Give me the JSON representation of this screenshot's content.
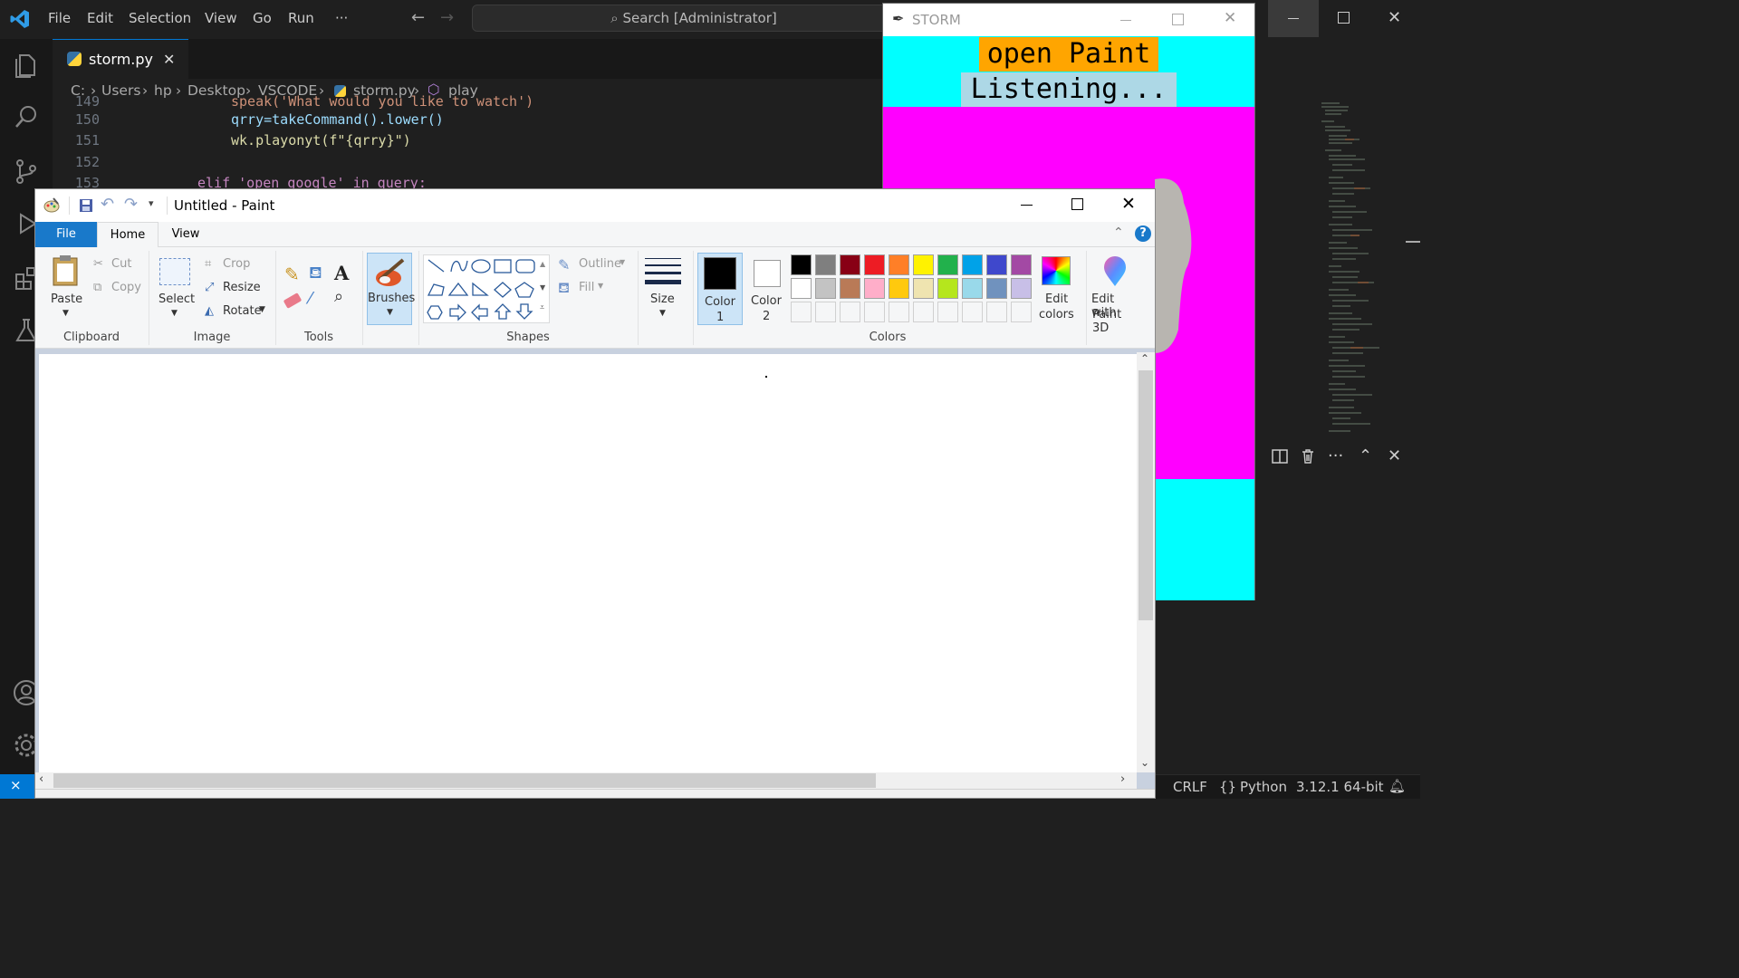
{
  "vscode": {
    "menu": [
      "File",
      "Edit",
      "Selection",
      "View",
      "Go",
      "Run",
      "···"
    ],
    "search_placeholder": "Search [Administrator]",
    "tab": {
      "label": "storm.py",
      "close": "✕"
    },
    "breadcrumb": [
      "C:",
      "Users",
      "hp",
      "Desktop",
      "VSCODE",
      "storm.py",
      "play"
    ],
    "code_lines": [
      {
        "num": "149",
        "text": "speak('What would you like to watch')"
      },
      {
        "num": "150",
        "text": "qrry=takeCommand().lower()"
      },
      {
        "num": "151",
        "text": "wk.playonyt(f\"{qrry}\")"
      },
      {
        "num": "152",
        "text": ""
      },
      {
        "num": "153",
        "text": "elif 'open google' in query:"
      }
    ],
    "status": {
      "eol": "CRLF",
      "language": "Python",
      "interpreter": "3.12.1 64-bit"
    },
    "colors": {
      "accent": "#0078d4",
      "bg": "#1f1f1f"
    }
  },
  "storm": {
    "title": "STORM",
    "command_text": "open Paint",
    "status_text": "Listening...",
    "colors": {
      "cyan": "#00ffff",
      "magenta": "#ff00ff",
      "orange": "#ffa500",
      "lightblue": "#add8e6"
    }
  },
  "paint": {
    "title": "Untitled - Paint",
    "tabs": {
      "file": "File",
      "home": "Home",
      "view": "View"
    },
    "clipboard": {
      "paste": "Paste",
      "cut": "Cut",
      "copy": "Copy",
      "group": "Clipboard"
    },
    "image": {
      "select": "Select",
      "crop": "Crop",
      "resize": "Resize",
      "rotate": "Rotate",
      "group": "Image"
    },
    "tools": {
      "group": "Tools"
    },
    "brushes": "Brushes",
    "shapes": {
      "outline": "Outline",
      "fill": "Fill",
      "group": "Shapes"
    },
    "size": "Size",
    "colors": {
      "color1": "Color\n1",
      "color1_a": "Color",
      "color1_b": "1",
      "color2_a": "Color",
      "color2_b": "2",
      "edit_colors_a": "Edit",
      "edit_colors_b": "colors",
      "paint3d_a": "Edit with",
      "paint3d_b": "Paint 3D",
      "group": "Colors",
      "palette_row1": [
        "#000000",
        "#7f7f7f",
        "#880015",
        "#ed1c24",
        "#ff7f27",
        "#fff200",
        "#22b14c",
        "#00a2e8",
        "#3f48cc",
        "#a349a4"
      ],
      "palette_row2": [
        "#ffffff",
        "#c3c3c3",
        "#b97a57",
        "#ffaec9",
        "#ffc90e",
        "#efe4b0",
        "#b5e61d",
        "#99d9ea",
        "#7092be",
        "#c8bfe7"
      ]
    }
  }
}
